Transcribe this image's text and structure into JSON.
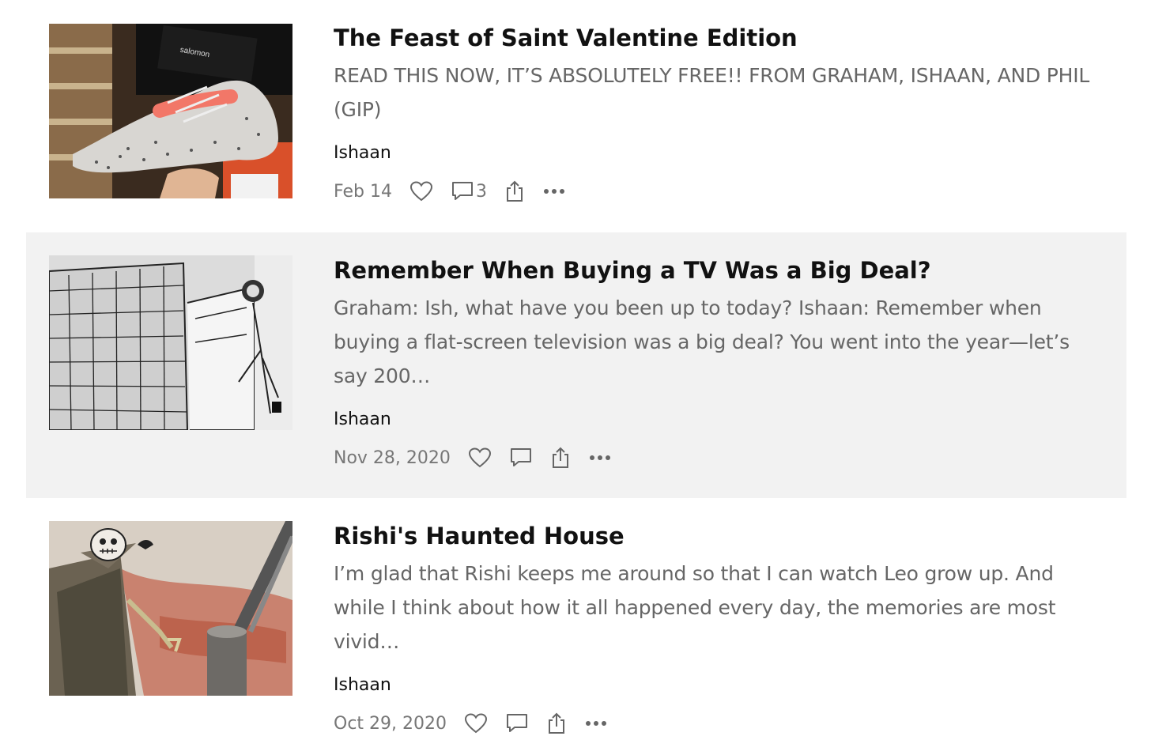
{
  "posts": [
    {
      "title": "The Feast of Saint Valentine Edition",
      "subtitle": "READ THIS NOW, IT’S ABSOLUTELY FREE!! FROM GRAHAM, ISHAAN, AND PHIL (GIP)",
      "author": "Ishaan",
      "date": "Feb 14",
      "comment_count": "3",
      "image": "sneaker-photo",
      "shoe_brand": "salomon"
    },
    {
      "title": "Remember When Buying a TV Was a Big Deal?",
      "subtitle": "Graham: Ish, what have you been up to today? Ishaan: Remember when buying a flat-screen television was a big deal? You went into the year—let’s say 200…",
      "author": "Ishaan",
      "date": "Nov 28, 2020",
      "comment_count": "",
      "image": "store-aisle-drawing"
    },
    {
      "title": "Rishi's Haunted House",
      "subtitle": "I’m glad that Rishi keeps me around so that I can watch Leo grow up. And while I think about how it all happened every day, the memories are most vivid…",
      "author": "Ishaan",
      "date": "Oct 29, 2020",
      "comment_count": "",
      "image": "scarecrow-drawing"
    }
  ],
  "icons": {
    "like": "heart-icon",
    "comment": "comment-icon",
    "share": "share-icon",
    "more": "more-icon"
  },
  "colors": {
    "highlight_bg": "#f2f2f2",
    "title": "#111111",
    "subtitle": "#666666",
    "meta": "#777777"
  }
}
